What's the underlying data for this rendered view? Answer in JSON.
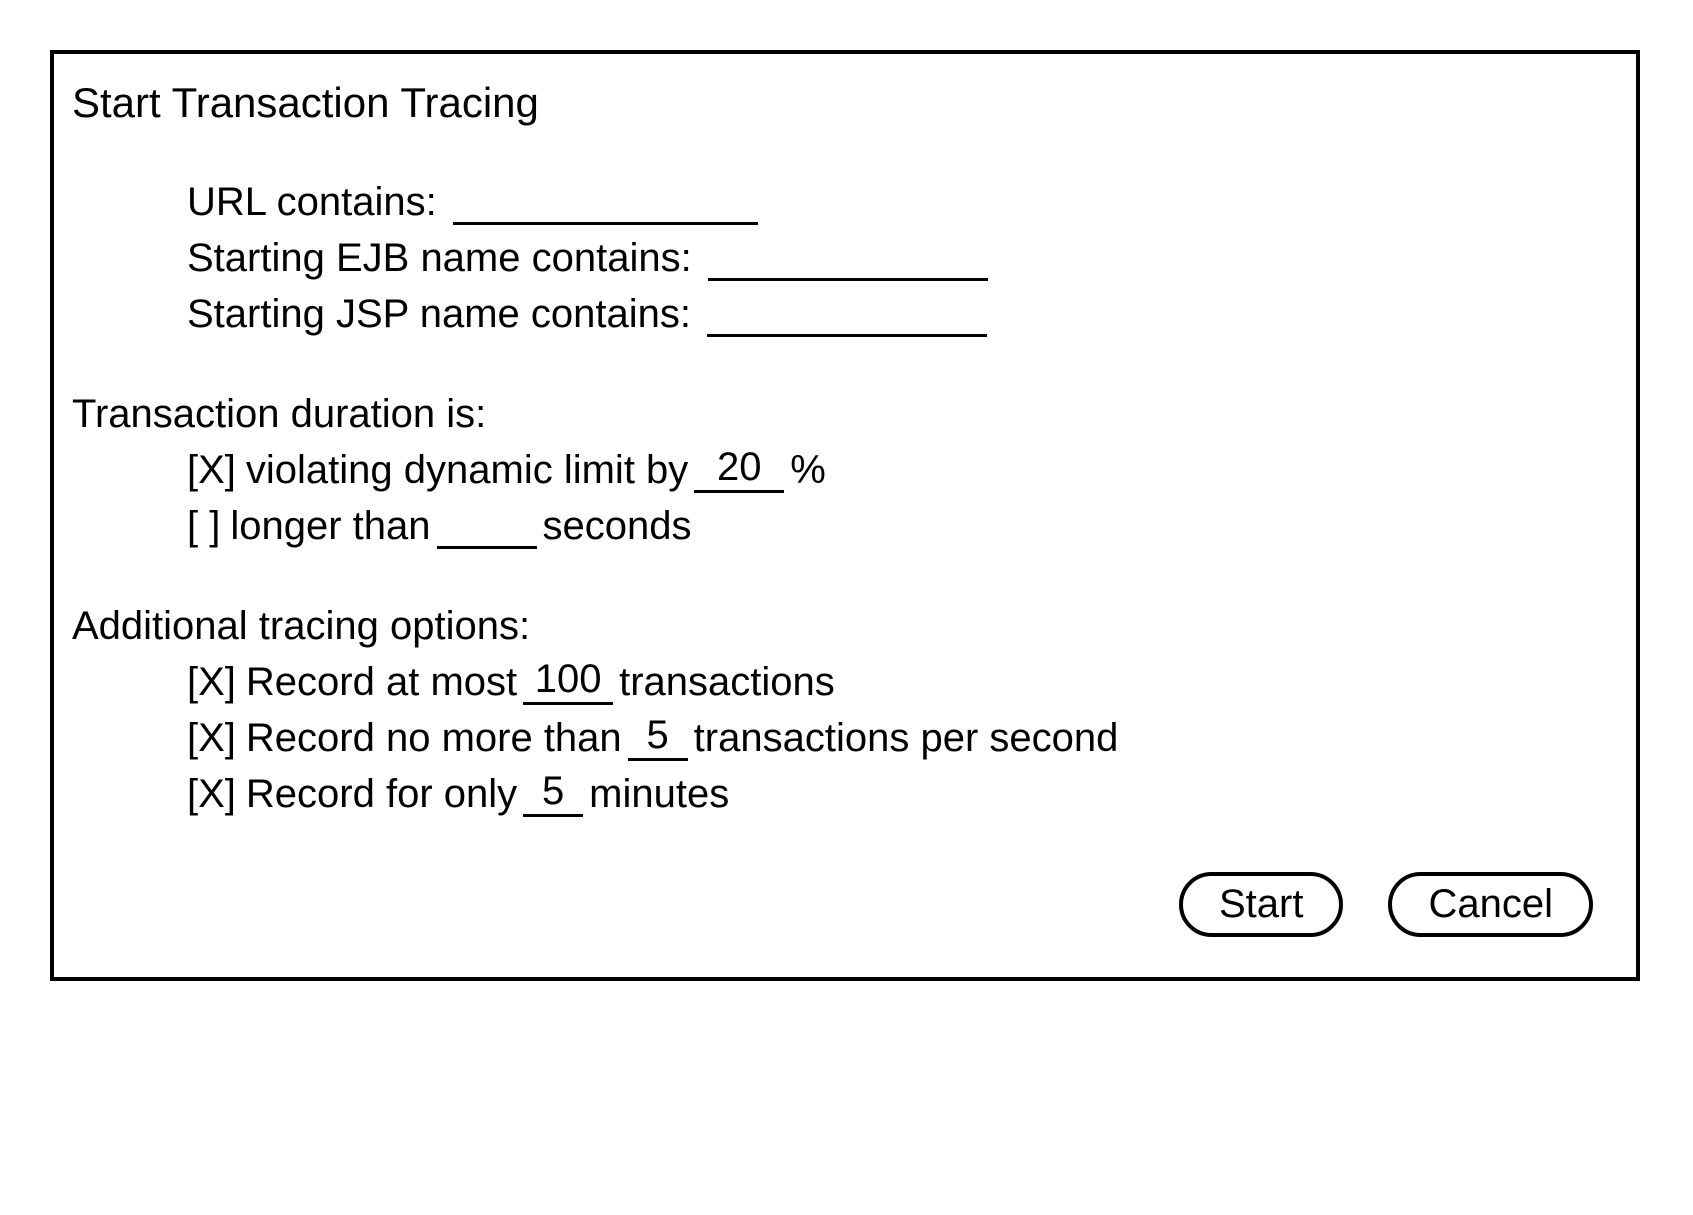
{
  "title": "Start Transaction Tracing",
  "filters": {
    "url": {
      "label": "URL contains:",
      "value": ""
    },
    "ejb": {
      "label": "Starting EJB name contains:",
      "value": ""
    },
    "jsp": {
      "label": "Starting JSP name contains:",
      "value": ""
    }
  },
  "duration": {
    "heading": "Transaction duration is:",
    "violating": {
      "checked": "[X]",
      "prefix": "violating dynamic limit by",
      "value": "20",
      "suffix": "%"
    },
    "longer": {
      "checked": "[  ]",
      "prefix": "longer than",
      "value": "",
      "suffix": "seconds"
    }
  },
  "additional": {
    "heading": "Additional tracing options:",
    "atmost": {
      "checked": "[X]",
      "prefix": "Record at most",
      "value": "100",
      "suffix": "transactions"
    },
    "nomore": {
      "checked": "[X]",
      "prefix": "Record no more than",
      "value": "5",
      "suffix": "transactions per second"
    },
    "foronly": {
      "checked": "[X]",
      "prefix": "Record for only",
      "value": "5",
      "suffix": "minutes"
    }
  },
  "buttons": {
    "start": "Start",
    "cancel": "Cancel"
  }
}
